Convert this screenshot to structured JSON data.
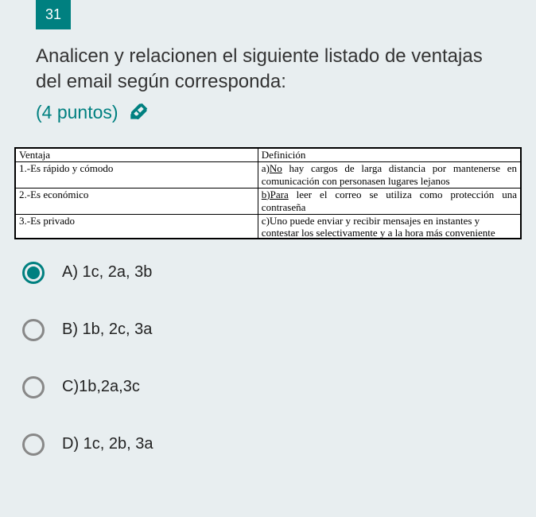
{
  "question_number": "31",
  "question_text": "Analicen y relacionen el siguiente listado de ventajas del email según corresponda:",
  "points_text": "(4 puntos)",
  "table": {
    "header_left": "Ventaja",
    "header_right": "Definición",
    "rows": [
      {
        "left": "1.-Es rápido y cómodo",
        "right_prefix": "a)",
        "right_underlined": "No",
        "right_rest": " hay cargos de larga distancia por mantenerse en comunicación con personasen lugares lejanos"
      },
      {
        "left": "2.-Es económico",
        "right_prefix": "",
        "right_underlined": "b)Para",
        "right_rest": " leer el correo se utiliza como protección una contraseña"
      },
      {
        "left": "3.-Es privado",
        "right_prefix": "c)Uno puede enviar y recibir mensajes en instantes y ",
        "right_underlined": "",
        "right_rest": "",
        "cutoff": "contestar los selectivamente y a la hora más conveniente"
      }
    ]
  },
  "options": [
    {
      "label": "A) 1c, 2a, 3b",
      "selected": true
    },
    {
      "label": "B) 1b, 2c, 3a",
      "selected": false
    },
    {
      "label": "C)1b,2a,3c",
      "selected": false
    },
    {
      "label": "D) 1c, 2b, 3a",
      "selected": false
    }
  ]
}
